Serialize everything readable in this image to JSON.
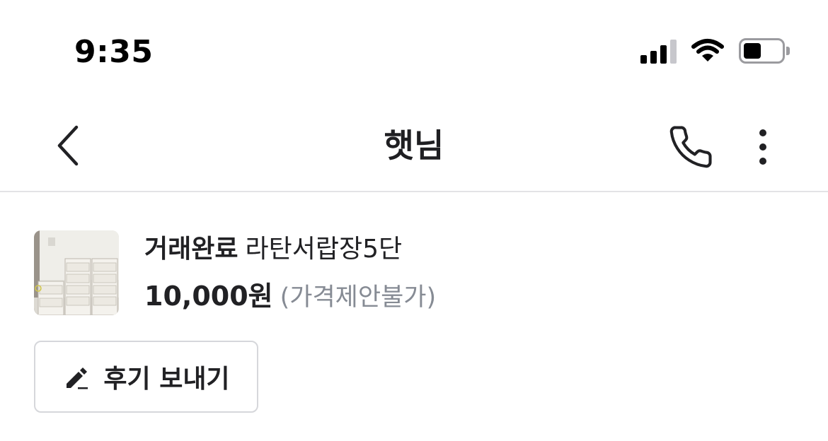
{
  "status_bar": {
    "time": "9:35",
    "icons": [
      "cellular-signal-icon",
      "wifi-icon",
      "battery-icon"
    ]
  },
  "header": {
    "title": "햇님",
    "back_icon": "chevron-left-icon",
    "call_icon": "phone-icon",
    "more_icon": "vertical-ellipsis-icon"
  },
  "product": {
    "status": "거래완료",
    "title": "라탄서랍장5단",
    "price": "10,000원",
    "price_note": "(가격제안불가)"
  },
  "actions": {
    "review_label": "후기 보내기",
    "review_icon": "pencil-icon"
  },
  "colors": {
    "text_primary": "#212124",
    "text_secondary": "#868b94",
    "divider": "#e3e3e6",
    "button_border": "#d6d7db"
  }
}
